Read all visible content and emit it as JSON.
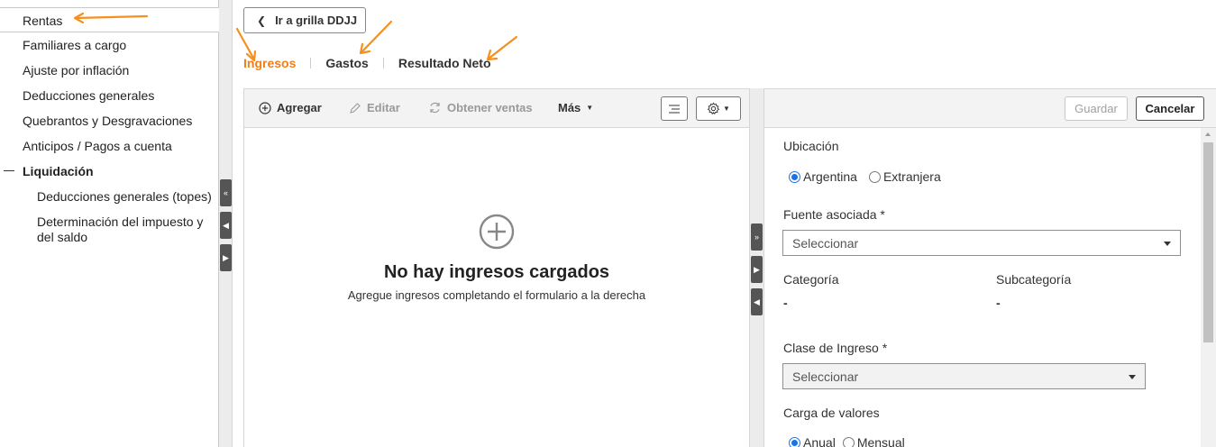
{
  "sidebar": {
    "items": [
      {
        "label": "Rentas"
      },
      {
        "label": "Familiares a cargo"
      },
      {
        "label": "Ajuste por inflación"
      },
      {
        "label": "Deducciones generales"
      },
      {
        "label": "Quebrantos y Desgravaciones"
      },
      {
        "label": "Anticipos / Pagos a cuenta"
      },
      {
        "label": "Liquidación"
      },
      {
        "label": "Deducciones generales (topes)"
      },
      {
        "label": "Determinación del impuesto y"
      },
      {
        "label": "del saldo"
      }
    ]
  },
  "back_button": {
    "label": "Ir a grilla DDJJ",
    "icon": "chevron-left-icon"
  },
  "tabs": [
    {
      "label": "Ingresos",
      "active": true
    },
    {
      "label": "Gastos",
      "active": false
    },
    {
      "label": "Resultado Neto",
      "active": false
    }
  ],
  "toolbar": {
    "add_label": "Agregar",
    "edit_label": "Editar",
    "sales_label": "Obtener ventas",
    "more_label": "Más"
  },
  "empty_state": {
    "title": "No hay ingresos cargados",
    "subtitle": "Agregue ingresos completando el formulario a la derecha"
  },
  "form": {
    "save_label": "Guardar",
    "cancel_label": "Cancelar",
    "ubicacion_label": "Ubicación",
    "ubicacion_options": [
      {
        "label": "Argentina",
        "checked": true
      },
      {
        "label": "Extranjera",
        "checked": false
      }
    ],
    "fuente_label": "Fuente asociada *",
    "fuente_placeholder": "Seleccionar",
    "categoria_label": "Categoría",
    "categoria_value": "-",
    "subcategoria_label": "Subcategoría",
    "subcategoria_value": "-",
    "clase_label": "Clase de Ingreso *",
    "clase_placeholder": "Seleccionar",
    "carga_label": "Carga de valores",
    "carga_options": [
      {
        "label": "Anual",
        "checked": true
      },
      {
        "label": "Mensual",
        "checked": false
      }
    ]
  },
  "colors": {
    "accent": "#f07f1a",
    "annotation_arrow": "#f5901e",
    "radio_checked": "#1a73e8"
  }
}
